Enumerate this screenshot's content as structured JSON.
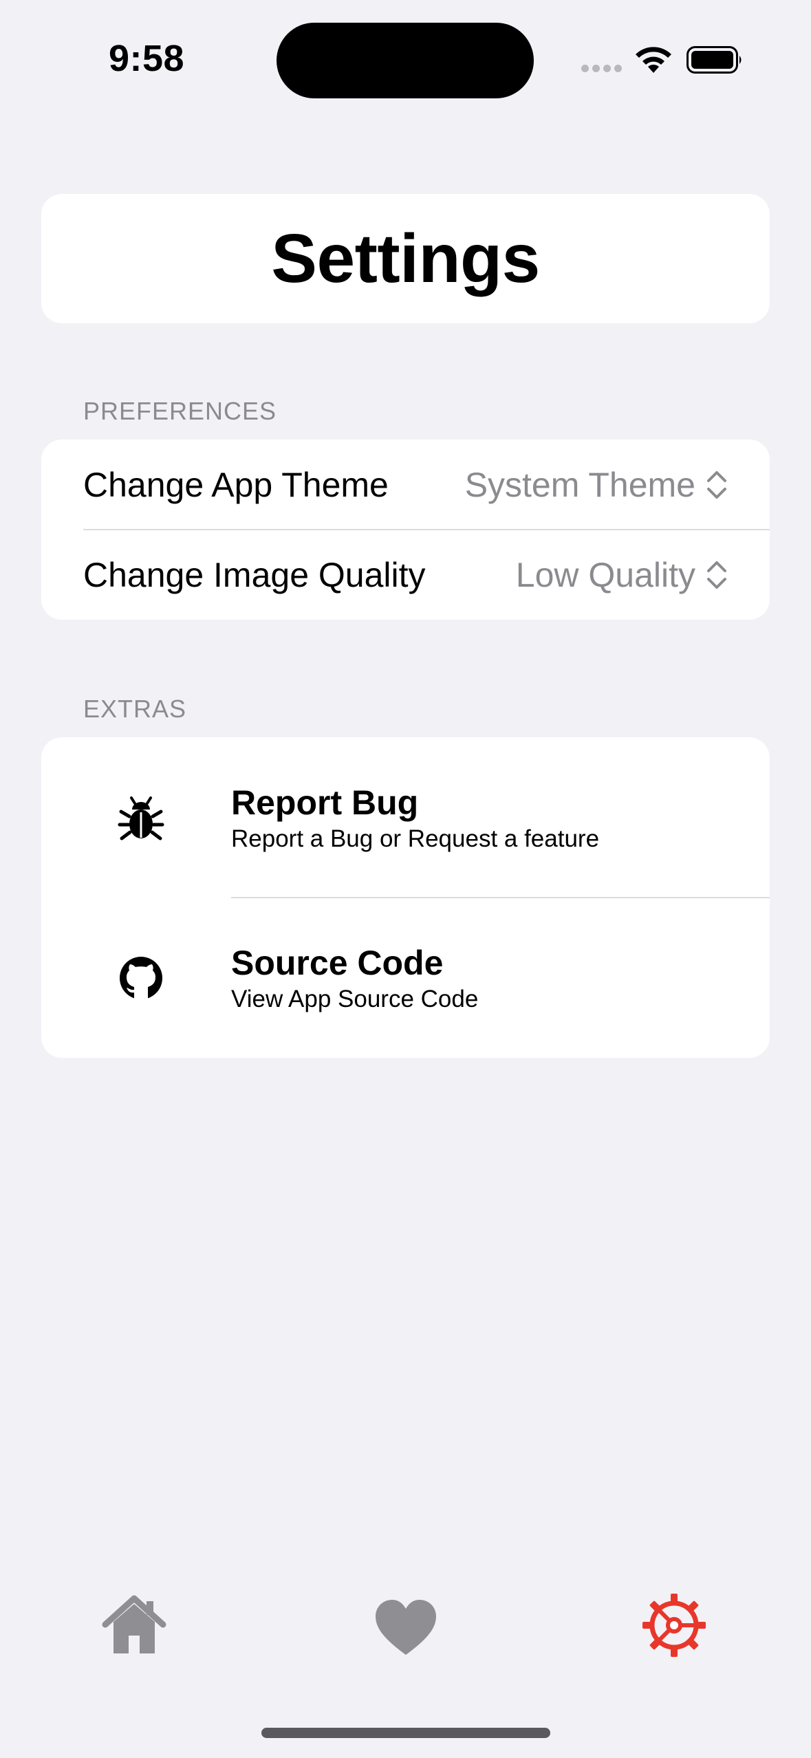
{
  "status_bar": {
    "time": "9:58"
  },
  "header": {
    "title": "Settings"
  },
  "preferences": {
    "header": "PREFERENCES",
    "rows": [
      {
        "label": "Change App Theme",
        "value": "System Theme"
      },
      {
        "label": "Change Image Quality",
        "value": "Low Quality"
      }
    ]
  },
  "extras": {
    "header": "EXTRAS",
    "rows": [
      {
        "icon": "bug-icon",
        "title": "Report Bug",
        "subtitle": "Report a Bug or Request a feature"
      },
      {
        "icon": "github-icon",
        "title": "Source Code",
        "subtitle": "View App Source Code"
      }
    ]
  },
  "tab_bar": {
    "items": [
      {
        "icon": "home-icon",
        "selected": false
      },
      {
        "icon": "heart-icon",
        "selected": false
      },
      {
        "icon": "gear-icon",
        "selected": true
      }
    ],
    "inactive_color": "#8E8E93",
    "active_color": "#E8362B"
  }
}
